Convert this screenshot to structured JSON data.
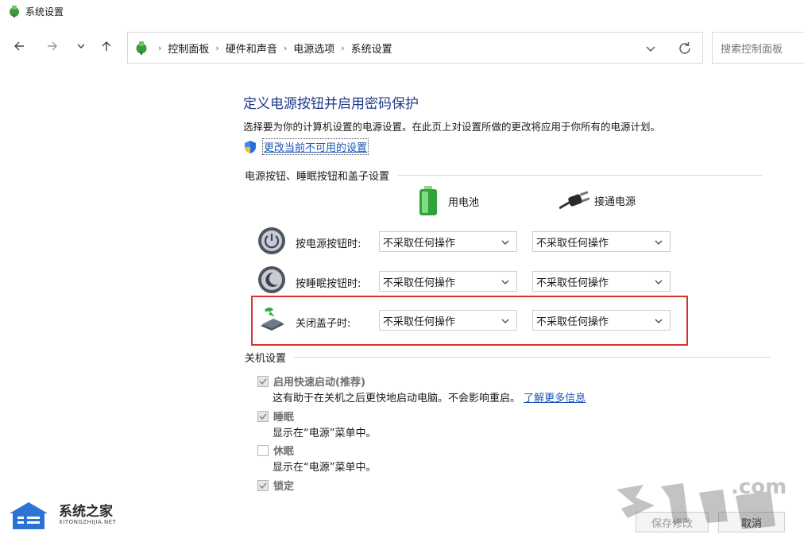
{
  "window": {
    "title": "系统设置"
  },
  "nav": {
    "breadcrumbs": [
      "控制面板",
      "硬件和声音",
      "电源选项",
      "系统设置"
    ],
    "search_placeholder": "搜索控制面板"
  },
  "page": {
    "title": "定义电源按钮并启用密码保护",
    "description": "选择要为你的计算机设置的电源设置。在此页上对设置所做的更改将应用于你所有的电源计划。",
    "change_link": "更改当前不可用的设置"
  },
  "power_section": {
    "heading": "电源按钮、睡眠按钮和盖子设置",
    "columns": [
      "用电池",
      "接通电源"
    ],
    "rows": [
      {
        "label": "按电源按钮时:",
        "battery": "不采取任何操作",
        "plugged": "不采取任何操作"
      },
      {
        "label": "按睡眠按钮时:",
        "battery": "不采取任何操作",
        "plugged": "不采取任何操作"
      },
      {
        "label": "关闭盖子时:",
        "battery": "不采取任何操作",
        "plugged": "不采取任何操作"
      }
    ]
  },
  "shutdown_section": {
    "heading": "关机设置",
    "items": [
      {
        "label": "启用快速启动(推荐)",
        "checked": true,
        "desc": "这有助于在关机之后更快地启动电脑。不会影响重启。",
        "link": "了解更多信息"
      },
      {
        "label": "睡眠",
        "checked": true,
        "desc": "显示在“电源”菜单中。"
      },
      {
        "label": "休眠",
        "checked": false,
        "desc": "显示在“电源”菜单中。"
      },
      {
        "label": "锁定",
        "checked": true
      }
    ]
  },
  "buttons": {
    "save": "保存修改",
    "cancel": "取消"
  },
  "watermarks": {
    "left_title": "系统之家",
    "left_sub": "XITONGZHIJIA.NET",
    "right_text": ".com"
  },
  "colors": {
    "highlight": "#d9312b",
    "link": "#1a55b5",
    "title": "#1e3b8a"
  }
}
